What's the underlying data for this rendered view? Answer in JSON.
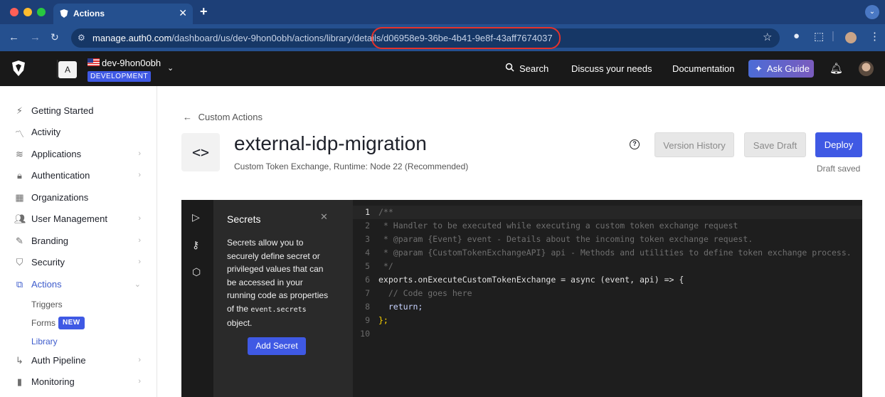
{
  "browser": {
    "tab_title": "Actions",
    "url_host": "manage.auth0.com",
    "url_path": "/dashboard/us/dev-9hon0obh/actions/library/details/d06958e9-36be-4b41-9e8f-43aff7674037",
    "highlight_color": "#e5322b"
  },
  "header": {
    "tenant_initial": "A",
    "tenant_name": "dev-9hon0obh",
    "env_badge": "DEVELOPMENT",
    "search": "Search",
    "discuss": "Discuss your needs",
    "docs": "Documentation",
    "ask_guide": "Ask Guide"
  },
  "sidebar": {
    "items": [
      {
        "label": "Getting Started",
        "icon": "bolt-icon"
      },
      {
        "label": "Activity",
        "icon": "activity-icon"
      },
      {
        "label": "Applications",
        "icon": "layers-icon"
      },
      {
        "label": "Authentication",
        "icon": "lock-icon"
      },
      {
        "label": "Organizations",
        "icon": "building-icon"
      },
      {
        "label": "User Management",
        "icon": "users-icon"
      },
      {
        "label": "Branding",
        "icon": "pen-icon"
      },
      {
        "label": "Security",
        "icon": "shield-icon"
      },
      {
        "label": "Actions",
        "icon": "actions-icon"
      },
      {
        "label": "Auth Pipeline",
        "icon": "pipeline-icon"
      },
      {
        "label": "Monitoring",
        "icon": "chart-icon"
      }
    ],
    "sub_items": {
      "triggers": "Triggers",
      "forms": "Forms",
      "forms_badge": "NEW",
      "library": "Library"
    }
  },
  "main": {
    "back_link": "Custom Actions",
    "title": "external-idp-migration",
    "subtitle": "Custom Token Exchange, Runtime: Node 22 (Recommended)",
    "version_history": "Version History",
    "save_draft": "Save Draft",
    "deploy": "Deploy",
    "draft_status": "Draft saved"
  },
  "secrets_panel": {
    "title": "Secrets",
    "desc_before": "Secrets allow you to securely define secret or privileged values that can be accessed in your running code as properties of the",
    "desc_code": "event.secrets",
    "desc_after": "object.",
    "add_button": "Add Secret"
  },
  "code": {
    "lines": [
      "/**",
      " * Handler to be executed while executing a custom token exchange request",
      " * @param {Event} event - Details about the incoming token exchange request.",
      " * @param {CustomTokenExchangeAPI} api - Methods and utilities to define token exchange process.",
      " */",
      "exports.onExecuteCustomTokenExchange = async (event, api) => {",
      "  // Code goes here",
      "  return;",
      "};",
      ""
    ]
  }
}
